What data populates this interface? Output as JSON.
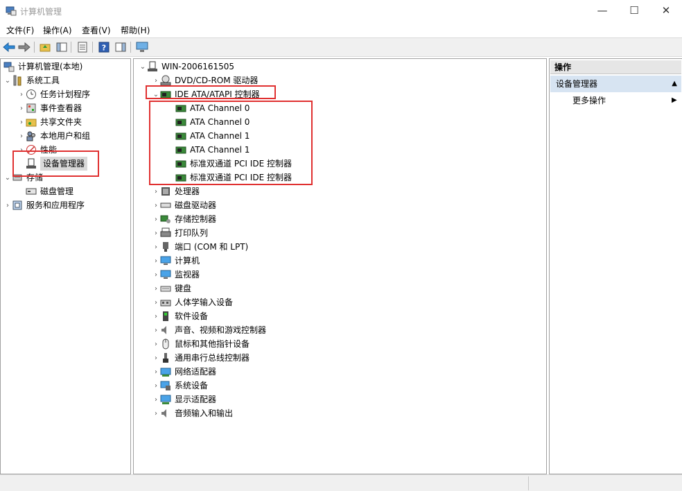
{
  "window": {
    "title": "计算机管理",
    "minimize": "—",
    "maximize": "☐",
    "close": "✕"
  },
  "menu": [
    "文件(F)",
    "操作(A)",
    "查看(V)",
    "帮助(H)"
  ],
  "left_tree": {
    "root": "计算机管理(本地)",
    "system_tools": "系统工具",
    "task_scheduler": "任务计划程序",
    "event_viewer": "事件查看器",
    "shared_folders": "共享文件夹",
    "local_users": "本地用户和组",
    "performance": "性能",
    "device_manager": "设备管理器",
    "storage": "存储",
    "disk_management": "磁盘管理",
    "services_apps": "服务和应用程序"
  },
  "device_tree": {
    "computer": "WIN-2006161505",
    "dvd": "DVD/CD-ROM 驱动器",
    "ide": "IDE ATA/ATAPI 控制器",
    "ide_children": [
      "ATA Channel 0",
      "ATA Channel 0",
      "ATA Channel 1",
      "ATA Channel 1",
      "标准双通道 PCI IDE 控制器",
      "标准双通道 PCI IDE 控制器"
    ],
    "categories": [
      "处理器",
      "磁盘驱动器",
      "存储控制器",
      "打印队列",
      "端口 (COM 和 LPT)",
      "计算机",
      "监视器",
      "键盘",
      "人体学输入设备",
      "软件设备",
      "声音、视频和游戏控制器",
      "鼠标和其他指针设备",
      "通用串行总线控制器",
      "网络适配器",
      "系统设备",
      "显示适配器",
      "音频输入和输出"
    ]
  },
  "actions": {
    "header": "操作",
    "section": "设备管理器",
    "more": "更多操作"
  },
  "colors": {
    "highlight_box": "#e03030",
    "section_bg": "#d7e4f2"
  }
}
